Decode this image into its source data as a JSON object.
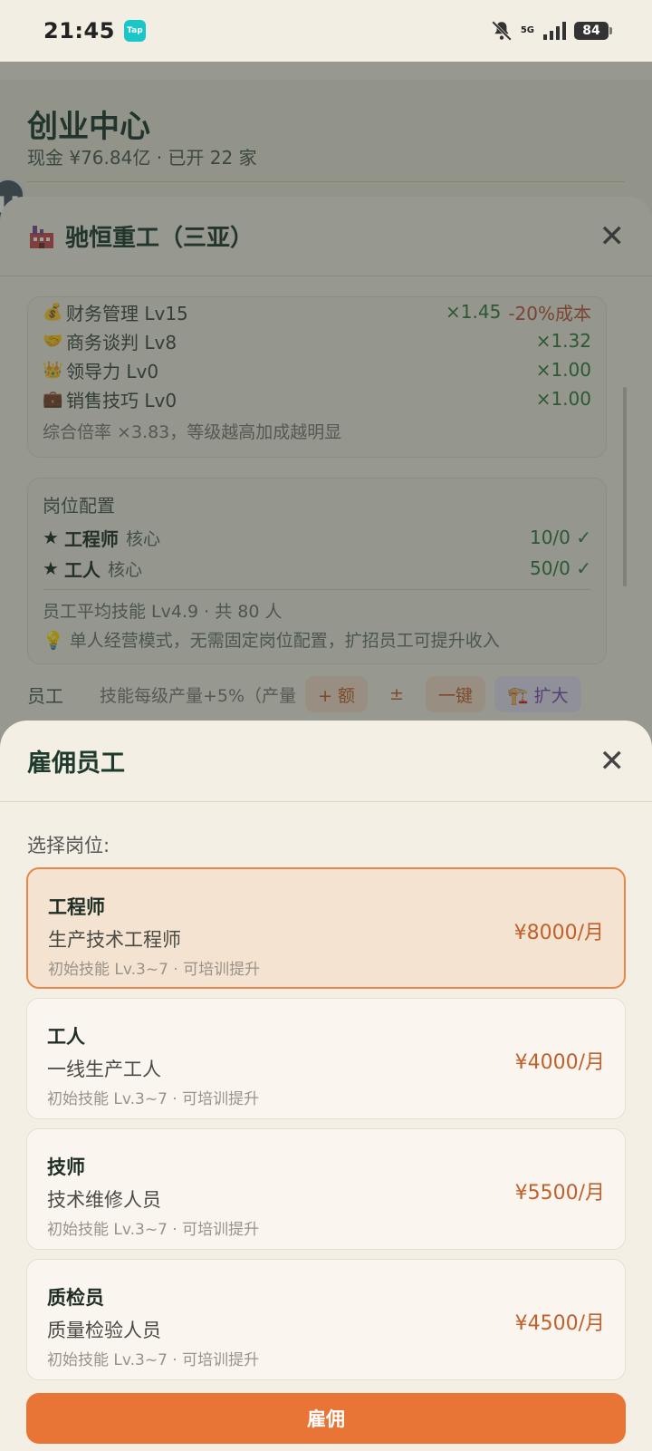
{
  "status_bar": {
    "time": "21:45",
    "app_badge": "Tap",
    "network": "5G",
    "battery": "84"
  },
  "background": {
    "title": "创业中心",
    "subtitle": "现金 ¥76.84亿 · 已开 22 家"
  },
  "detail": {
    "title": "驰恒重工（三亚）",
    "skills": [
      {
        "icon": "💰",
        "name": "财务管理 Lv15",
        "mult": "×1.45",
        "extra": "-20%成本"
      },
      {
        "icon": "🤝",
        "name": "商务谈判 Lv8",
        "mult": "×1.32",
        "extra": ""
      },
      {
        "icon": "👑",
        "name": "领导力 Lv0",
        "mult": "×1.00",
        "extra": ""
      },
      {
        "icon": "💼",
        "name": "销售技巧 Lv0",
        "mult": "×1.00",
        "extra": ""
      }
    ],
    "skill_summary": "综合倍率 ×3.83，等级越高加成越明显",
    "positions_title": "岗位配置",
    "positions": [
      {
        "star": "★",
        "name": "工程师",
        "tag": "核心",
        "value": "10/0 ✓"
      },
      {
        "star": "★",
        "name": "工人",
        "tag": "核心",
        "value": "50/0 ✓"
      }
    ],
    "avg_skill": "员工平均技能 Lv4.9 · 共 80 人",
    "note": "💡 单人经营模式，无需固定岗位配置，扩招员工可提升收入",
    "employees_label": "员工",
    "employees_desc": "技能每级产量+5%（产量",
    "btn_quota": "+ 额",
    "btn_pm": "±",
    "btn_one_click": "一键",
    "btn_expand": "🏗️ 扩大"
  },
  "hire": {
    "title": "雇佣员工",
    "select_label": "选择岗位:",
    "roles": [
      {
        "name": "工程师",
        "desc": "生产技术工程师",
        "skill": "初始技能 Lv.3~7 · 可培训提升",
        "salary": "¥8000/月"
      },
      {
        "name": "工人",
        "desc": "一线生产工人",
        "skill": "初始技能 Lv.3~7 · 可培训提升",
        "salary": "¥4000/月"
      },
      {
        "name": "技师",
        "desc": "技术维修人员",
        "skill": "初始技能 Lv.3~7 · 可培训提升",
        "salary": "¥5500/月"
      },
      {
        "name": "质检员",
        "desc": "质量检验人员",
        "skill": "初始技能 Lv.3~7 · 可培训提升",
        "salary": "¥4500/月"
      }
    ],
    "selected_index": 0,
    "button_label": "雇佣"
  },
  "colors": {
    "accent": "#e87536",
    "selected_bg": "#f5e3d2",
    "salary": "#c0602a",
    "positive": "#2f7a3f"
  }
}
